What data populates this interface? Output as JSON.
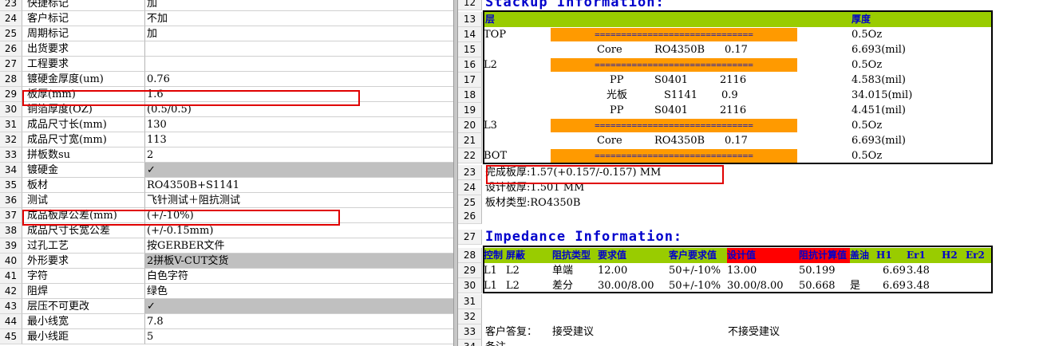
{
  "left": {
    "rows": [
      {
        "n": "23",
        "label": "快捷标记",
        "value": "加",
        "gray": false
      },
      {
        "n": "24",
        "label": "客户标记",
        "value": "不加",
        "gray": false
      },
      {
        "n": "25",
        "label": "周期标记",
        "value": "加",
        "gray": false
      },
      {
        "n": "26",
        "label": "出货要求",
        "value": "",
        "gray": false
      },
      {
        "n": "27",
        "label": "工程要求",
        "value": "",
        "gray": false
      },
      {
        "n": "28",
        "label": "镀硬金厚度(um)",
        "value": "0.76",
        "gray": false
      },
      {
        "n": "29",
        "label": "板厚(mm)",
        "value": "1.6",
        "gray": false
      },
      {
        "n": "30",
        "label": "铜箔厚度(OZ)",
        "value": "(0.5/0.5)",
        "gray": false
      },
      {
        "n": "31",
        "label": "成品尺寸长(mm)",
        "value": "130",
        "gray": false
      },
      {
        "n": "32",
        "label": "成品尺寸宽(mm)",
        "value": "113",
        "gray": false
      },
      {
        "n": "33",
        "label": "拼板数su",
        "value": "2",
        "gray": false
      },
      {
        "n": "34",
        "label": "镀硬金",
        "value": "✓",
        "gray": true
      },
      {
        "n": "35",
        "label": "板材",
        "value": "RO4350B+S1141",
        "gray": false
      },
      {
        "n": "36",
        "label": "测试",
        "value": "飞针测试＋阻抗测试",
        "gray": false
      },
      {
        "n": "37",
        "label": "成品板厚公差(mm)",
        "value": "(+/-10%)",
        "gray": false
      },
      {
        "n": "38",
        "label": "成品尺寸长宽公差",
        "value": "(+/-0.15mm)",
        "gray": false
      },
      {
        "n": "39",
        "label": "过孔工艺",
        "value": "按GERBER文件",
        "gray": false
      },
      {
        "n": "40",
        "label": "外形要求",
        "value": "2拼板V-CUT交货",
        "gray": true
      },
      {
        "n": "41",
        "label": "字符",
        "value": "白色字符",
        "gray": false
      },
      {
        "n": "42",
        "label": "阻焊",
        "value": "绿色",
        "gray": false
      },
      {
        "n": "43",
        "label": "层压不可更改",
        "value": "✓",
        "gray": true
      },
      {
        "n": "44",
        "label": "最小线宽",
        "value": "7.8",
        "gray": false
      },
      {
        "n": "45",
        "label": "最小线距",
        "value": "5",
        "gray": false
      }
    ]
  },
  "right": {
    "stackup_title": "Stackup Information:",
    "stackup_header": {
      "col1": "层",
      "col2": "厚度"
    },
    "stackup_rows": [
      {
        "n": "14",
        "layer": "TOP",
        "bar": "==============================",
        "mat": "",
        "code": "",
        "val": "",
        "thick": "0.5Oz"
      },
      {
        "n": "15",
        "layer": "",
        "bar": "",
        "mat": "Core",
        "code": "RO4350B",
        "val": "0.17",
        "thick": "6.693(mil)"
      },
      {
        "n": "16",
        "layer": "L2",
        "bar": "==============================",
        "mat": "",
        "code": "",
        "val": "",
        "thick": "0.5Oz"
      },
      {
        "n": "17",
        "layer": "",
        "bar": "",
        "mat": "PP",
        "code": "S0401",
        "val": "2116",
        "thick": "4.583(mil)"
      },
      {
        "n": "18",
        "layer": "",
        "bar": "",
        "mat": "光板",
        "code": "S1141",
        "val": "0.9",
        "thick": "34.015(mil)"
      },
      {
        "n": "19",
        "layer": "",
        "bar": "",
        "mat": "PP",
        "code": "S0401",
        "val": "2116",
        "thick": "4.451(mil)"
      },
      {
        "n": "20",
        "layer": "L3",
        "bar": "==============================",
        "mat": "",
        "code": "",
        "val": "",
        "thick": "0.5Oz"
      },
      {
        "n": "21",
        "layer": "",
        "bar": "",
        "mat": "Core",
        "code": "RO4350B",
        "val": "0.17",
        "thick": "6.693(mil)"
      },
      {
        "n": "22",
        "layer": "BOT",
        "bar": "==============================",
        "mat": "",
        "code": "",
        "val": "",
        "thick": "0.5Oz"
      }
    ],
    "summary": [
      {
        "n": "23",
        "text": "完成板厚:1.57(+0.157/-0.157) MM"
      },
      {
        "n": "24",
        "text": "设计板厚:1.501 MM"
      },
      {
        "n": "25",
        "text": "板材类型:RO4350B"
      }
    ],
    "impedance_title": "Impedance Information:",
    "imp_header": [
      "控制",
      "屏蔽",
      "阻抗类型",
      "要求值",
      "客户要求值",
      "设计值",
      "阻抗计算值",
      "盖油",
      "H1",
      "Er1",
      "H2",
      "Er2"
    ],
    "imp_rows": [
      {
        "n": "29",
        "c": [
          "L1",
          "L2",
          "单端",
          "12.00",
          "50+/-10%",
          "13.00",
          "50.199",
          "",
          "6.69",
          "3.48",
          "",
          ""
        ]
      },
      {
        "n": "30",
        "c": [
          "L1",
          "L2",
          "差分",
          "30.00/8.00",
          "50+/-10%",
          "30.00/8.00",
          "50.668",
          "是",
          "6.69",
          "3.48",
          "",
          ""
        ]
      }
    ],
    "reply": {
      "label": "客户答复：",
      "accept": "接受建议",
      "reject": "不接受建议"
    },
    "note": "备注"
  }
}
